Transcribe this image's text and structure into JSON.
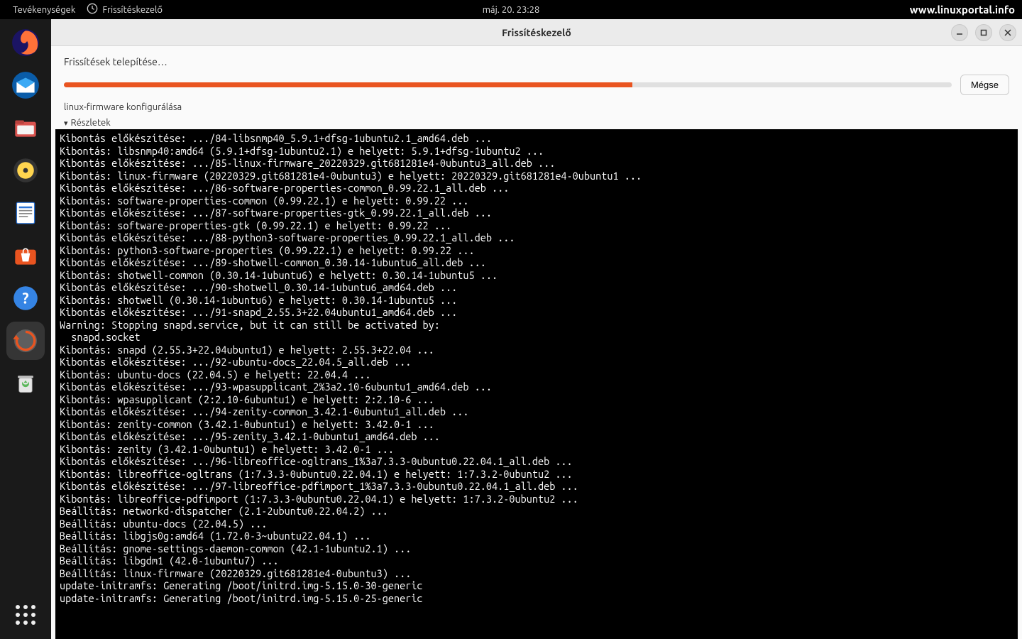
{
  "top_panel": {
    "activities": "Tevékenységek",
    "app_name": "Frissítéskezelő",
    "clock": "máj. 20.  23:28",
    "watermark": "www.linuxportal.info"
  },
  "dock": {
    "items": [
      {
        "name": "firefox-icon"
      },
      {
        "name": "thunderbird-icon"
      },
      {
        "name": "files-icon"
      },
      {
        "name": "rhythmbox-icon"
      },
      {
        "name": "libreoffice-writer-icon"
      },
      {
        "name": "ubuntu-software-icon"
      },
      {
        "name": "help-icon"
      },
      {
        "name": "software-updater-icon",
        "active": true
      },
      {
        "name": "trash-icon"
      }
    ]
  },
  "window": {
    "title": "Frissítéskezelő",
    "heading": "Frissítések telepítése…",
    "status": "linux-firmware konfigurálása",
    "details_label": "Részletek",
    "cancel_label": "Mégse",
    "progress_percent": 64,
    "terminal_lines": [
      "Kibontás előkészítése: .../84-libsnmp40_5.9.1+dfsg-1ubuntu2.1_amd64.deb ...",
      "Kibontás: libsnmp40:amd64 (5.9.1+dfsg-1ubuntu2.1) e helyett: 5.9.1+dfsg-1ubuntu2 ...",
      "Kibontás előkészítése: .../85-linux-firmware_20220329.git681281e4-0ubuntu3_all.deb ...",
      "Kibontás: linux-firmware (20220329.git681281e4-0ubuntu3) e helyett: 20220329.git681281e4-0ubuntu1 ...",
      "Kibontás előkészítése: .../86-software-properties-common_0.99.22.1_all.deb ...",
      "Kibontás: software-properties-common (0.99.22.1) e helyett: 0.99.22 ...",
      "Kibontás előkészítése: .../87-software-properties-gtk_0.99.22.1_all.deb ...",
      "Kibontás: software-properties-gtk (0.99.22.1) e helyett: 0.99.22 ...",
      "Kibontás előkészítése: .../88-python3-software-properties_0.99.22.1_all.deb ...",
      "Kibontás: python3-software-properties (0.99.22.1) e helyett: 0.99.22 ...",
      "Kibontás előkészítése: .../89-shotwell-common_0.30.14-1ubuntu6_all.deb ...",
      "Kibontás: shotwell-common (0.30.14-1ubuntu6) e helyett: 0.30.14-1ubuntu5 ...",
      "Kibontás előkészítése: .../90-shotwell_0.30.14-1ubuntu6_amd64.deb ...",
      "Kibontás: shotwell (0.30.14-1ubuntu6) e helyett: 0.30.14-1ubuntu5 ...",
      "Kibontás előkészítése: .../91-snapd_2.55.3+22.04ubuntu1_amd64.deb ...",
      "Warning: Stopping snapd.service, but it can still be activated by:",
      "  snapd.socket",
      "Kibontás: snapd (2.55.3+22.04ubuntu1) e helyett: 2.55.3+22.04 ...",
      "Kibontás előkészítése: .../92-ubuntu-docs_22.04.5_all.deb ...",
      "Kibontás: ubuntu-docs (22.04.5) e helyett: 22.04.4 ...",
      "Kibontás előkészítése: .../93-wpasupplicant_2%3a2.10-6ubuntu1_amd64.deb ...",
      "Kibontás: wpasupplicant (2:2.10-6ubuntu1) e helyett: 2:2.10-6 ...",
      "Kibontás előkészítése: .../94-zenity-common_3.42.1-0ubuntu1_all.deb ...",
      "Kibontás: zenity-common (3.42.1-0ubuntu1) e helyett: 3.42.0-1 ...",
      "Kibontás előkészítése: .../95-zenity_3.42.1-0ubuntu1_amd64.deb ...",
      "Kibontás: zenity (3.42.1-0ubuntu1) e helyett: 3.42.0-1 ...",
      "Kibontás előkészítése: .../96-libreoffice-ogltrans_1%3a7.3.3-0ubuntu0.22.04.1_all.deb ...",
      "Kibontás: libreoffice-ogltrans (1:7.3.3-0ubuntu0.22.04.1) e helyett: 1:7.3.2-0ubuntu2 ...",
      "Kibontás előkészítése: .../97-libreoffice-pdfimport_1%3a7.3.3-0ubuntu0.22.04.1_all.deb ...",
      "Kibontás: libreoffice-pdfimport (1:7.3.3-0ubuntu0.22.04.1) e helyett: 1:7.3.2-0ubuntu2 ...",
      "Beállítás: networkd-dispatcher (2.1-2ubuntu0.22.04.2) ...",
      "Beállítás: ubuntu-docs (22.04.5) ...",
      "Beállítás: libgjs0g:amd64 (1.72.0-3~ubuntu22.04.1) ...",
      "Beállítás: gnome-settings-daemon-common (42.1-1ubuntu2.1) ...",
      "Beállítás: libgdm1 (42.0-1ubuntu7) ...",
      "Beállítás: linux-firmware (20220329.git681281e4-0ubuntu3) ...",
      "update-initramfs: Generating /boot/initrd.img-5.15.0-30-generic",
      "update-initramfs: Generating /boot/initrd.img-5.15.0-25-generic"
    ]
  }
}
